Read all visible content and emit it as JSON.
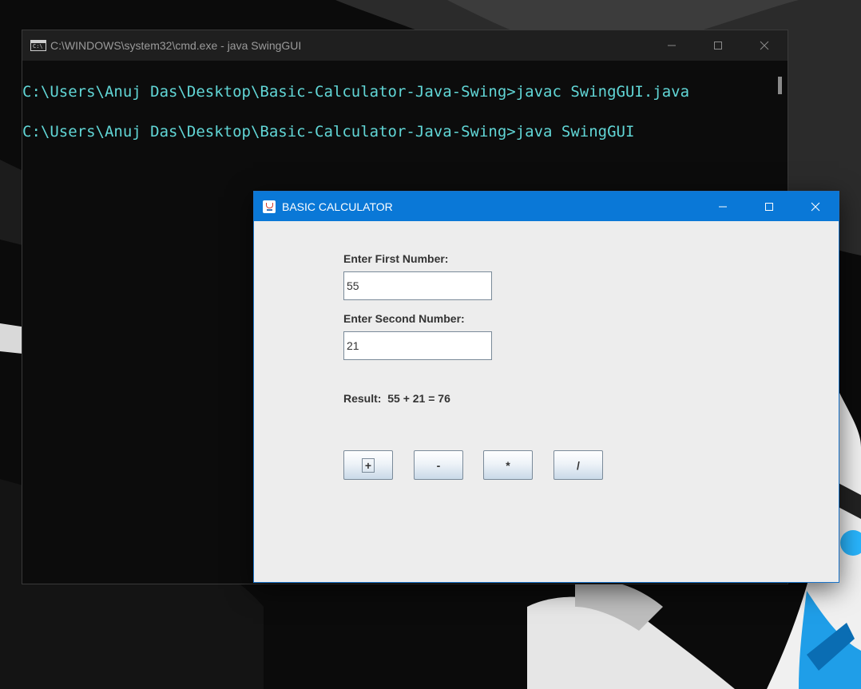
{
  "cmd_window": {
    "title": "C:\\WINDOWS\\system32\\cmd.exe - java  SwingGUI",
    "lines": [
      "C:\\Users\\Anuj Das\\Desktop\\Basic-Calculator-Java-Swing>javac SwingGUI.java",
      "C:\\Users\\Anuj Das\\Desktop\\Basic-Calculator-Java-Swing>java SwingGUI"
    ],
    "text_color": "#61d6d6"
  },
  "calculator": {
    "title": "BASIC CALCULATOR",
    "first_label": "Enter First Number:",
    "first_value": "55",
    "second_label": "Enter Second Number:",
    "second_value": "21",
    "result_text": "Result:  55 + 21 = 76",
    "buttons": {
      "add": "+",
      "subtract": "-",
      "multiply": "*",
      "divide": "/"
    },
    "titlebar_color": "#0a78d7"
  },
  "icons": {
    "cmd_app": "cmd-icon",
    "java_app": "java-icon",
    "minimize": "minimize-icon",
    "maximize": "maximize-icon",
    "close": "close-icon"
  }
}
